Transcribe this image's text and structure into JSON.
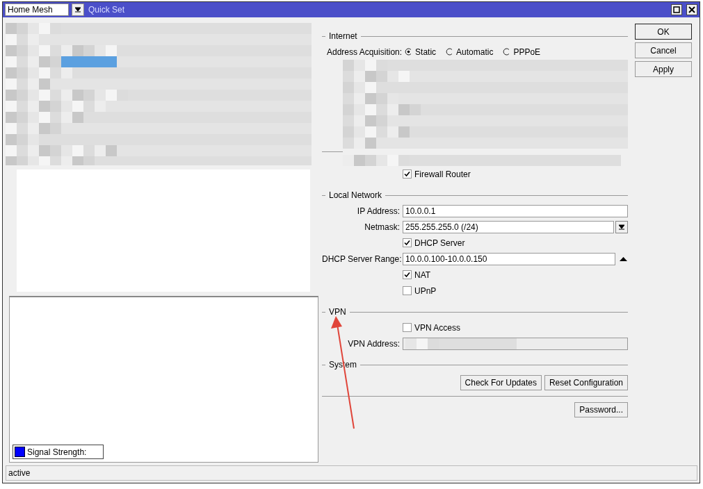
{
  "window": {
    "title": "Quick Set",
    "mode_select": {
      "value": "Home Mesh"
    }
  },
  "internet": {
    "title": "Internet",
    "address_acquisition": {
      "label": "Address Acquisition:",
      "options": [
        {
          "label": "Static",
          "selected": true
        },
        {
          "label": "Automatic",
          "selected": false
        },
        {
          "label": "PPPoE",
          "selected": false
        }
      ]
    },
    "firewall_router": {
      "label": "Firewall Router",
      "checked": true
    }
  },
  "local_network": {
    "title": "Local Network",
    "ip_address": {
      "label": "IP Address:",
      "value": "10.0.0.1"
    },
    "netmask": {
      "label": "Netmask:",
      "value": "255.255.255.0 (/24)"
    },
    "dhcp_server": {
      "label": "DHCP Server",
      "checked": true
    },
    "dhcp_server_range": {
      "label": "DHCP Server Range:",
      "value": "10.0.0.100-10.0.0.150"
    },
    "nat": {
      "label": "NAT",
      "checked": true
    },
    "upnp": {
      "label": "UPnP",
      "checked": false
    }
  },
  "vpn": {
    "title": "VPN",
    "vpn_access": {
      "label": "VPN Access",
      "checked": false
    },
    "vpn_address": {
      "label": "VPN Address:",
      "disabled": true
    }
  },
  "system": {
    "title": "System",
    "buttons": [
      "Check For Updates",
      "Reset Configuration"
    ],
    "password_button": "Password..."
  },
  "dialog_buttons": [
    {
      "label": "OK",
      "default": true
    },
    {
      "label": "Cancel",
      "default": false
    },
    {
      "label": "Apply",
      "default": false
    }
  ],
  "left_panel": {
    "legend": {
      "label": "Signal Strength:"
    }
  },
  "status_bar": {
    "text": "active"
  }
}
